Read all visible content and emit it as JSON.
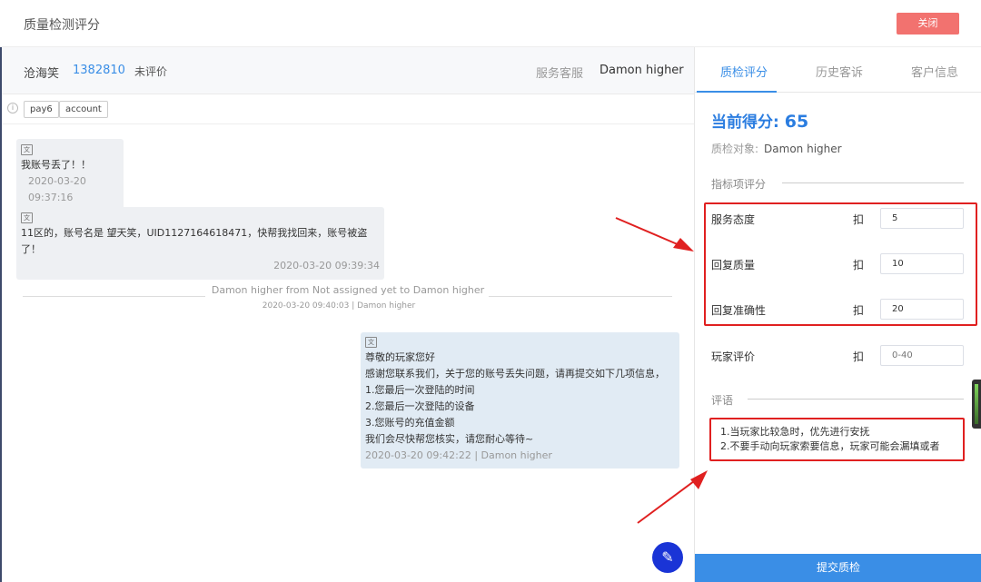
{
  "header": {
    "title": "质量检测评分",
    "close_label": "关闭"
  },
  "chat_header": {
    "customer_name": "沧海笑",
    "uid": "1382810",
    "status": "未评价",
    "service_label": "服务客服",
    "agent_name": "Damon higher"
  },
  "tags": [
    "pay6",
    "account"
  ],
  "messages": [
    {
      "text": "我账号丢了！！",
      "time": "2020-03-20 09:37:16"
    },
    {
      "text": "11区的，账号名是 望天笑，UID1127164618471，快帮我找回来，账号被盗了！",
      "time": "2020-03-20 09:39:34"
    }
  ],
  "system_event": {
    "text": "Damon higher from Not assigned yet to Damon higher",
    "sub": "2020-03-20 09:40:03 | Damon higher"
  },
  "agent_message": {
    "lines": [
      "尊敬的玩家您好",
      "感谢您联系我们，关于您的账号丢失问题，请再提交如下几项信息，",
      "1.您最后一次登陆的时间",
      "2.您最后一次登陆的设备",
      "3.您账号的充值金额",
      "我们会尽快帮您核实，请您耐心等待~"
    ],
    "time": "2020-03-20 09:42:22 | Damon higher"
  },
  "panel": {
    "tabs": [
      "质检评分",
      "历史客诉",
      "客户信息"
    ],
    "score_label": "当前得分: ",
    "score": "65",
    "target_label": "质检对象:",
    "target_value": "Damon higher",
    "indicator_title": "指标项评分",
    "deduct_label": "扣",
    "indicators": [
      {
        "label": "服务态度",
        "value": "5"
      },
      {
        "label": "回复质量",
        "value": "10"
      },
      {
        "label": "回复准确性",
        "value": "20"
      }
    ],
    "player_rating": {
      "label": "玩家评价",
      "placeholder": "0-40"
    },
    "comment_title": "评语",
    "comment_lines": [
      "1.当玩家比较急时，优先进行安抚",
      "2.不要手动向玩家索要信息，玩家可能会漏填或者"
    ],
    "submit_label": "提交质检"
  },
  "colors": {
    "accent": "#3a8ee6",
    "close": "#f2726f",
    "highlight": "#e02020",
    "fab": "#1a34d6"
  },
  "icons": {
    "fab": "edit-pencil-icon",
    "tag": "clock-icon",
    "message": "translate-icon"
  }
}
